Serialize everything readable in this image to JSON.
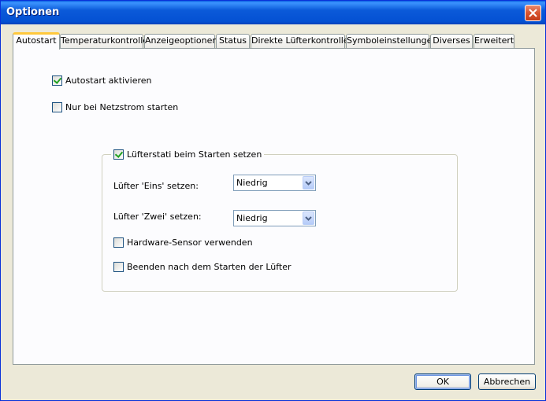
{
  "window": {
    "title": "Optionen"
  },
  "tabs": [
    {
      "label": "Autostart",
      "active": true
    },
    {
      "label": "Temperaturkontrolle"
    },
    {
      "label": "Anzeigeoptionen"
    },
    {
      "label": "Status"
    },
    {
      "label": "Direkte Lüfterkontrolle"
    },
    {
      "label": "Symboleinstellungen"
    },
    {
      "label": "Diverses"
    },
    {
      "label": "Erweitert"
    }
  ],
  "autostart": {
    "enable": {
      "label": "Autostart aktivieren",
      "checked": true
    },
    "mains_only": {
      "label": "Nur bei Netzstrom starten",
      "checked": false
    }
  },
  "fan_group": {
    "title_checkbox": {
      "label": "Lüfterstati beim Starten setzen",
      "checked": true
    },
    "fan1": {
      "label": "Lüfter 'Eins' setzen:",
      "value": "Niedrig"
    },
    "fan2": {
      "label": "Lüfter 'Zwei' setzen:",
      "value": "Niedrig"
    },
    "hw_sensor": {
      "label": "Hardware-Sensor verwenden",
      "checked": false
    },
    "exit_after": {
      "label": "Beenden nach dem Starten der Lüfter",
      "checked": false
    }
  },
  "buttons": {
    "ok": "OK",
    "cancel": "Abbrechen"
  },
  "icons": {
    "close": "close-icon",
    "dropdown": "chevron-down-icon",
    "check": "check-icon"
  }
}
